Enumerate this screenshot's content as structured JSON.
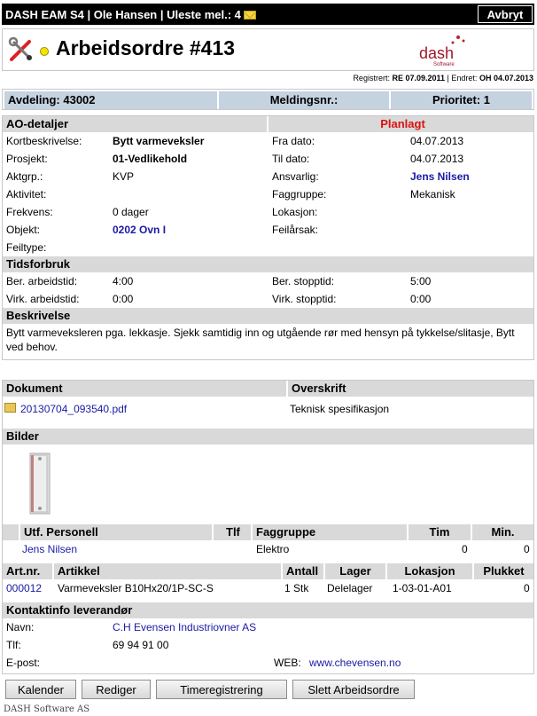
{
  "topbar": {
    "title": "DASH EAM S4 | Ole Hansen | Uleste mel.: 4",
    "cancel": "Avbryt"
  },
  "header": {
    "title": "Arbeidsordre #413",
    "logo_text": "dash",
    "logo_sub": "Software",
    "reg_label": "Registrert:",
    "reg_value": "RE 07.09.2011",
    "sep": "|",
    "endret_label": "Endret:",
    "endret_value": "OH 04.07.2013"
  },
  "summary": {
    "avdeling": "Avdeling: 43002",
    "meldingsnr": "Meldingsnr.:",
    "prioritet": "Prioritet: 1"
  },
  "ao": {
    "header": "AO-detaljer",
    "status": "Planlagt",
    "left": [
      {
        "label": "Kortbeskrivelse:",
        "value": "Bytt varmeveksler",
        "style": "bold"
      },
      {
        "label": "Prosjekt:",
        "value": "01-Vedlikehold",
        "style": "bold"
      },
      {
        "label": "Aktgrp.:",
        "value": "KVP",
        "style": ""
      },
      {
        "label": "Aktivitet:",
        "value": "",
        "style": ""
      },
      {
        "label": "Frekvens:",
        "value": "0 dager",
        "style": ""
      },
      {
        "label": "Objekt:",
        "value": "0202 Ovn I",
        "style": "link"
      },
      {
        "label": "Feiltype:",
        "value": "",
        "style": ""
      }
    ],
    "right": [
      {
        "label": "Fra dato:",
        "value": "04.07.2013",
        "style": ""
      },
      {
        "label": "Til dato:",
        "value": "04.07.2013",
        "style": ""
      },
      {
        "label": "Ansvarlig:",
        "value": "Jens Nilsen",
        "style": "link"
      },
      {
        "label": "Faggruppe:",
        "value": "Mekanisk",
        "style": ""
      },
      {
        "label": "Lokasjon:",
        "value": "",
        "style": ""
      },
      {
        "label": "Feilårsak:",
        "value": "",
        "style": ""
      }
    ]
  },
  "tids": {
    "header": "Tidsforbruk",
    "ber_arbeid_label": "Ber. arbeidstid:",
    "ber_arbeid": "4:00",
    "ber_stopp_label": "Ber. stopptid:",
    "ber_stopp": "5:00",
    "virk_arbeid_label": "Virk. arbeidstid:",
    "virk_arbeid": "0:00",
    "virk_stopp_label": "Virk. stopptid:",
    "virk_stopp": "0:00"
  },
  "beskrivelse": {
    "header": "Beskrivelse",
    "text": "Bytt varmeveksleren pga. lekkasje. Sjekk samtidig inn og utgående rør med hensyn på tykkelse/slitasje, Bytt ved behov."
  },
  "dokument": {
    "col1": "Dokument",
    "col2": "Overskrift",
    "file": "20130704_093540.pdf",
    "overskrift": "Teknisk spesifikasjon"
  },
  "bilder": {
    "header": "Bilder"
  },
  "personell": {
    "cols": [
      "Utf. Personell",
      "Tlf",
      "Faggruppe",
      "Tim",
      "Min."
    ],
    "name": "Jens Nilsen",
    "tlf": "",
    "faggruppe": "Elektro",
    "tim": "0",
    "min": "0"
  },
  "artikler": {
    "cols": [
      "Art.nr.",
      "Artikkel",
      "Antall",
      "Lager",
      "Lokasjon",
      "Plukket"
    ],
    "artnr": "000012",
    "artikkel": "Varmeveksler B10Hx20/1P-SC-S",
    "antall": "1 Stk",
    "lager": "Delelager",
    "lokasjon": "1-03-01-A01",
    "plukket": "0"
  },
  "kontakt": {
    "header": "Kontaktinfo leverandør",
    "navn_label": "Navn:",
    "navn": "C.H Evensen Industriovner AS",
    "tlf_label": "Tlf:",
    "tlf": "69 94 91 00",
    "epost_label": "E-post:",
    "epost": "",
    "web_label": "WEB:",
    "web": "www.chevensen.no"
  },
  "buttons": {
    "kalender": "Kalender",
    "rediger": "Rediger",
    "timereg": "Timeregistrering",
    "slett": "Slett Arbeidsordre"
  },
  "footer": "DASH Software AS",
  "colors": {
    "accent_red": "#dd1111",
    "link_blue": "#1a1aa6",
    "header_gray": "#d9d9d9",
    "status_dot": "#f6e300"
  }
}
